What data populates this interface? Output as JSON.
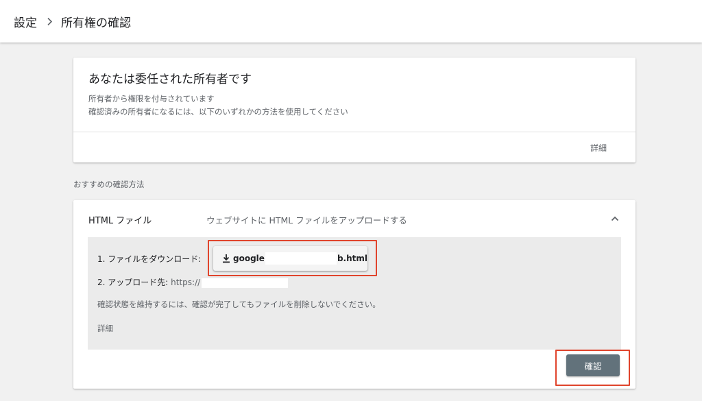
{
  "breadcrumb": {
    "parent": "設定",
    "current": "所有権の確認"
  },
  "owner_card": {
    "title": "あなたは委任された所有者です",
    "line1": "所有者から権限を付与されています",
    "line2": "確認済みの所有者になるには、以下のいずれかの方法を使用してください",
    "details_link": "詳細"
  },
  "recommended": {
    "label": "おすすめの確認方法"
  },
  "method": {
    "name": "HTML ファイル",
    "description": "ウェブサイトに HTML ファイルをアップロードする",
    "step1_label": "1. ファイルをダウンロード:",
    "download": {
      "prefix": "google",
      "suffix": "b.html"
    },
    "step2_label": "2. アップロード先:",
    "step2_url_prefix": "https://",
    "note": "確認状態を維持するには、確認が完了してもファイルを削除しないでください。",
    "details_link": "詳細"
  },
  "confirm_button": "確認",
  "colors": {
    "highlight": "#e0442c",
    "confirm_button": "#62727b",
    "panel_bg": "#ebebeb",
    "page_bg": "#f1f1f1"
  },
  "icons": {
    "breadcrumb_separator": "chevron-right-icon",
    "collapse": "chevron-up-icon",
    "download": "download-icon"
  }
}
